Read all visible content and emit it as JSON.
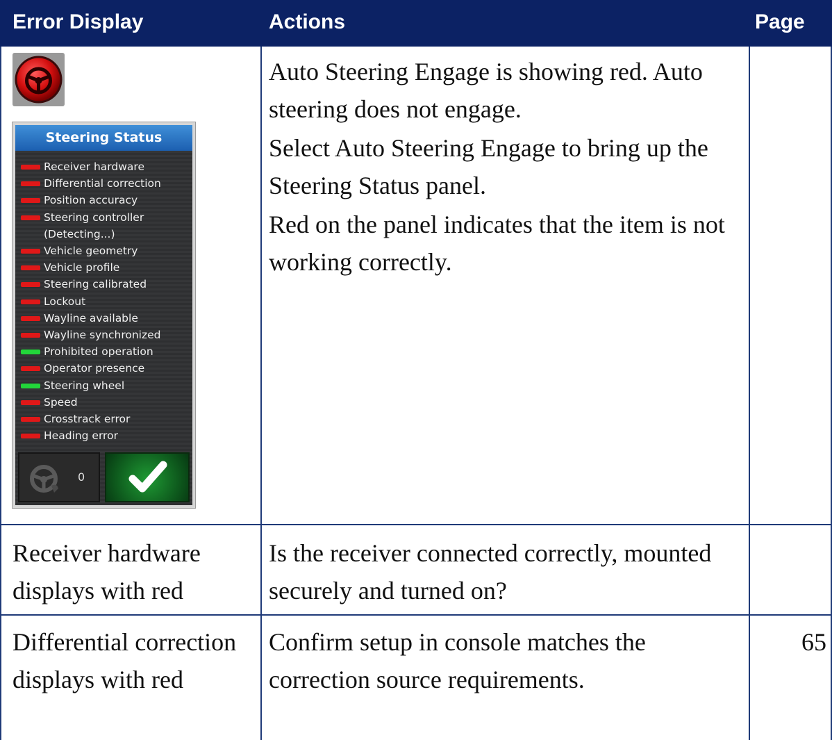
{
  "header": {
    "col_error": "Error Display",
    "col_actions": "Actions",
    "col_page": "Page"
  },
  "colors": {
    "header_bg": "#0c2264",
    "rule": "#1f3a78",
    "led_red": "#e01818",
    "led_green": "#22d63a"
  },
  "row1": {
    "engage_icon": "steering-wheel-icon",
    "panel": {
      "title": "Steering Status",
      "items": [
        {
          "label": "Receiver hardware",
          "status": "red"
        },
        {
          "label": "Differential correction",
          "status": "red"
        },
        {
          "label": "Position accuracy",
          "status": "red"
        },
        {
          "label": "Steering controller",
          "sub": "(Detecting...)",
          "status": "red"
        },
        {
          "label": "Vehicle geometry",
          "status": "red"
        },
        {
          "label": "Vehicle profile",
          "status": "red"
        },
        {
          "label": "Steering calibrated",
          "status": "red"
        },
        {
          "label": "Lockout",
          "status": "red"
        },
        {
          "label": "Wayline available",
          "status": "red"
        },
        {
          "label": "Wayline synchronized",
          "status": "red"
        },
        {
          "label": "Prohibited operation",
          "status": "green"
        },
        {
          "label": "Operator presence",
          "status": "red"
        },
        {
          "label": "Steering wheel",
          "status": "green"
        },
        {
          "label": "Speed",
          "status": "red"
        },
        {
          "label": "Crosstrack error",
          "status": "red"
        },
        {
          "label": "Heading error",
          "status": "red"
        }
      ],
      "left_button_count": "0",
      "left_button_icon": "steering-wheel-disabled-icon",
      "right_button_icon": "checkmark-icon"
    },
    "actions": [
      "Auto Steering Engage is showing red. Auto steering does not engage.",
      "Select Auto Steering Engage to bring up the Steering Status panel.",
      "Red on the panel indicates that the item is not working correctly."
    ],
    "page": ""
  },
  "row2": {
    "error": "Receiver hardware displays with red",
    "action": "Is the receiver connected correctly, mounted securely and turned on?",
    "page": ""
  },
  "row3": {
    "error": "Differential correction displays with red",
    "action": "Confirm setup in console matches the correction source requirements.",
    "page": "65"
  }
}
